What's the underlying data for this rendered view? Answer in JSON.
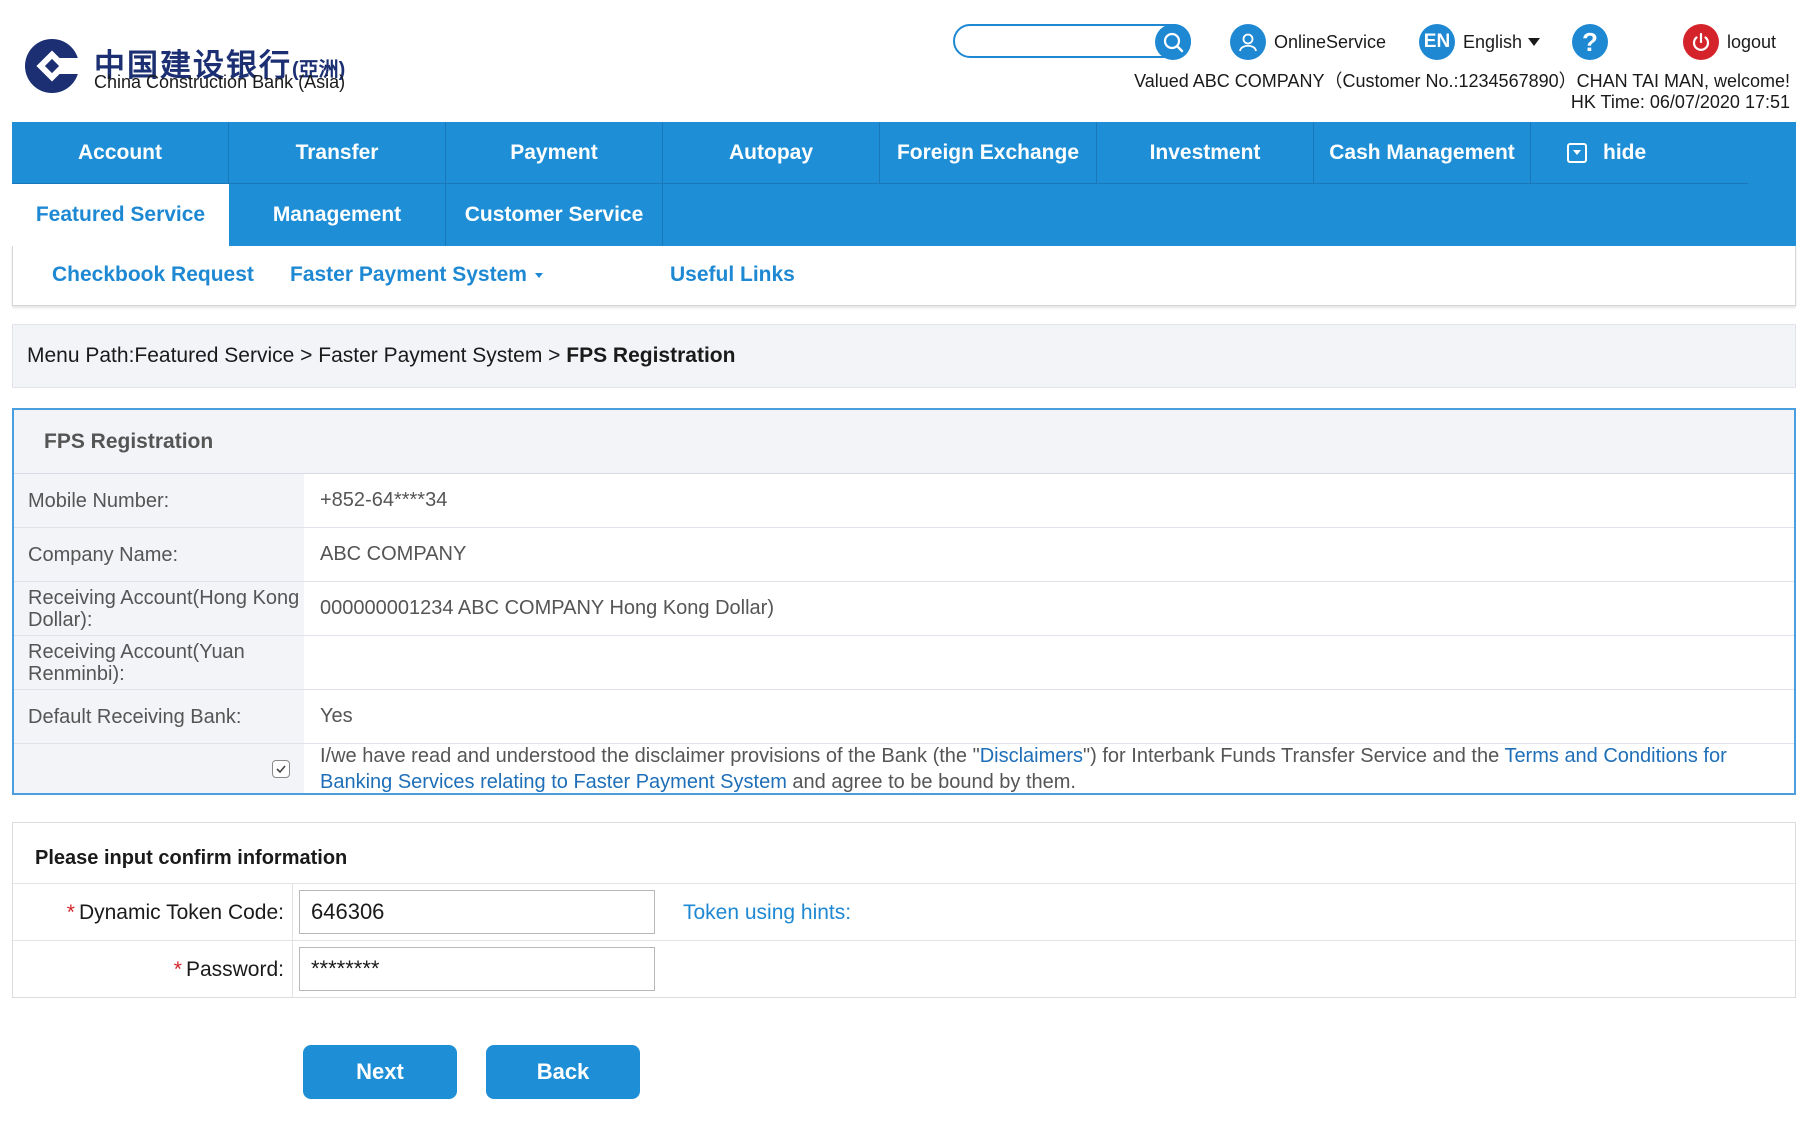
{
  "brand": {
    "name_cn": "中国建设银行",
    "name_cn_suffix": "(亞洲)",
    "name_en": "China Construction Bank (Asia)",
    "primary_color": "#1e8fd6",
    "dark_color": "#1b2f72"
  },
  "topbar": {
    "search_value": "",
    "online_service": "OnlineService",
    "language_badge": "EN",
    "language": "English",
    "help": "?",
    "logout": "logout",
    "welcome": "Valued ABC COMPANY（Customer No.:1234567890）CHAN TAI MAN, welcome!",
    "hk_time": "HK Time: 06/07/2020 17:51"
  },
  "nav": {
    "row1": [
      "Account",
      "Transfer",
      "Payment",
      "Autopay",
      "Foreign Exchange",
      "Investment",
      "Cash Management"
    ],
    "hide": "hide",
    "row2": [
      "Featured Service",
      "Management",
      "Customer Service"
    ],
    "active": "Featured Service"
  },
  "subnav": [
    "Checkbook Request",
    "Faster Payment System",
    "Useful Links"
  ],
  "breadcrumb": {
    "prefix": "Menu Path:Featured Service > Faster Payment System > ",
    "current": "FPS Registration"
  },
  "fps": {
    "title": "FPS Registration",
    "rows": [
      {
        "label": "Mobile Number:",
        "value": "+852-64****34"
      },
      {
        "label": "Company Name:",
        "value": "ABC COMPANY"
      },
      {
        "label": "Receiving Account(Hong Kong Dollar):",
        "value": "000000001234 ABC COMPANY Hong Kong Dollar)"
      },
      {
        "label": "Receiving Account(Yuan Renminbi):",
        "value": ""
      },
      {
        "label": "Default Receiving Bank:",
        "value": "Yes"
      }
    ],
    "agreement": {
      "checked": true,
      "text1": "I/we have read and understood the disclaimer provisions of the Bank (the \"",
      "link1": "Disclaimers",
      "text2": "\") for Interbank Funds Transfer Service and the ",
      "link2": "Terms and Conditions for Banking Services relating to Faster Payment System",
      "text3": " and agree to be bound by them."
    }
  },
  "confirm": {
    "title": "Please input confirm information",
    "required_mark": "*",
    "token_label": "Dynamic Token Code:",
    "token_value": "646306",
    "token_hint": "Token using hints:",
    "password_label": "Password:",
    "password_value": "********"
  },
  "actions": {
    "next": "Next",
    "back": "Back"
  }
}
